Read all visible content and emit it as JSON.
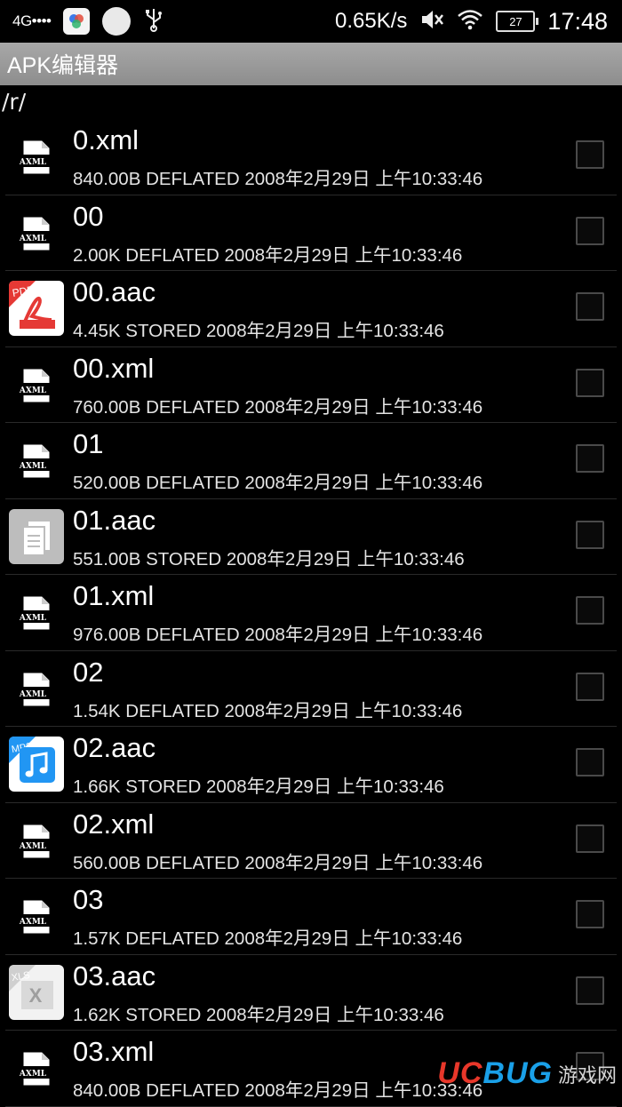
{
  "status_bar": {
    "network": "4G••••",
    "speed": "0.65K/s",
    "battery": "27",
    "time": "17:48",
    "icons": [
      "signal-icon",
      "app-icon",
      "circle-icon",
      "usb-icon",
      "mute-icon",
      "wifi-icon",
      "battery-icon"
    ]
  },
  "title_bar": {
    "title": "APK编辑器"
  },
  "path": "/r/",
  "files": [
    {
      "name": "0.xml",
      "meta": "840.00B DEFLATED 2008年2月29日 上午10:33:46",
      "icon": "axml"
    },
    {
      "name": "00",
      "meta": "2.00K DEFLATED 2008年2月29日 上午10:33:46",
      "icon": "axml"
    },
    {
      "name": "00.aac",
      "meta": "4.45K STORED 2008年2月29日 上午10:33:46",
      "icon": "pdf"
    },
    {
      "name": "00.xml",
      "meta": "760.00B DEFLATED 2008年2月29日 上午10:33:46",
      "icon": "axml"
    },
    {
      "name": "01",
      "meta": "520.00B DEFLATED 2008年2月29日 上午10:33:46",
      "icon": "axml"
    },
    {
      "name": "01.aac",
      "meta": "551.00B STORED 2008年2月29日 上午10:33:46",
      "icon": "doc"
    },
    {
      "name": "01.xml",
      "meta": "976.00B DEFLATED 2008年2月29日 上午10:33:46",
      "icon": "axml"
    },
    {
      "name": "02",
      "meta": "1.54K DEFLATED 2008年2月29日 上午10:33:46",
      "icon": "axml"
    },
    {
      "name": "02.aac",
      "meta": "1.66K STORED 2008年2月29日 上午10:33:46",
      "icon": "mp3"
    },
    {
      "name": "02.xml",
      "meta": "560.00B DEFLATED 2008年2月29日 上午10:33:46",
      "icon": "axml"
    },
    {
      "name": "03",
      "meta": "1.57K DEFLATED 2008年2月29日 上午10:33:46",
      "icon": "axml"
    },
    {
      "name": "03.aac",
      "meta": "1.62K STORED 2008年2月29日 上午10:33:46",
      "icon": "xls"
    },
    {
      "name": "03.xml",
      "meta": "840.00B DEFLATED 2008年2月29日 上午10:33:46",
      "icon": "axml"
    }
  ],
  "icon_labels": {
    "axml": "AXML",
    "pdf": "PDF",
    "mp3": "MP3",
    "xls": "XLS"
  },
  "watermark": {
    "brand_left": "UC",
    "brand_right": "BUG",
    "cn": "游戏网"
  },
  "colors": {
    "title_bar": "#9a9a9a",
    "background": "#000000",
    "pdf": "#e53935",
    "mp3": "#2196f3"
  }
}
